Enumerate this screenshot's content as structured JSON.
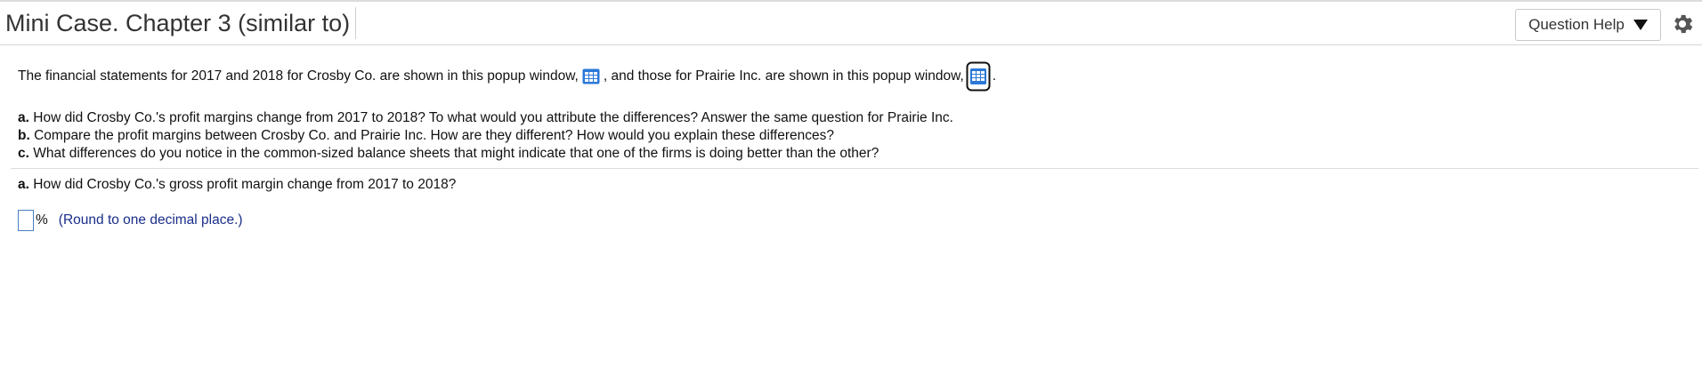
{
  "header": {
    "title": "Mini Case. Chapter 3 (similar to)",
    "help_label": "Question Help"
  },
  "intro": {
    "part1": "The financial statements for 2017 and 2018 for Crosby Co. are shown in this popup window,",
    "part2": ", and those for Prairie Inc. are shown in this popup window,",
    "part3": "."
  },
  "questions": [
    {
      "letter": "a.",
      "text": "How did Crosby Co.'s profit margins change from 2017 to 2018? To what would you attribute the differences? Answer the same question for Prairie Inc."
    },
    {
      "letter": "b.",
      "text": "Compare the profit margins between Crosby Co. and Prairie Inc. How are they different? How would you explain these differences?"
    },
    {
      "letter": "c.",
      "text": "What differences do you notice in the common-sized balance sheets that might indicate that one of the firms is doing better than the other?"
    }
  ],
  "current": {
    "letter": "a.",
    "text": "How did Crosby Co.'s gross profit margin change from 2017 to 2018?",
    "input_value": "",
    "unit": "%",
    "hint": "(Round to one decimal place.)"
  },
  "icons": {
    "table": "table-icon",
    "gear": "gear-icon",
    "caret": "caret-down-icon"
  },
  "colors": {
    "hint": "#1a2e8a",
    "table_icon": "#2b78d8",
    "input_border": "#4a7fc4"
  }
}
